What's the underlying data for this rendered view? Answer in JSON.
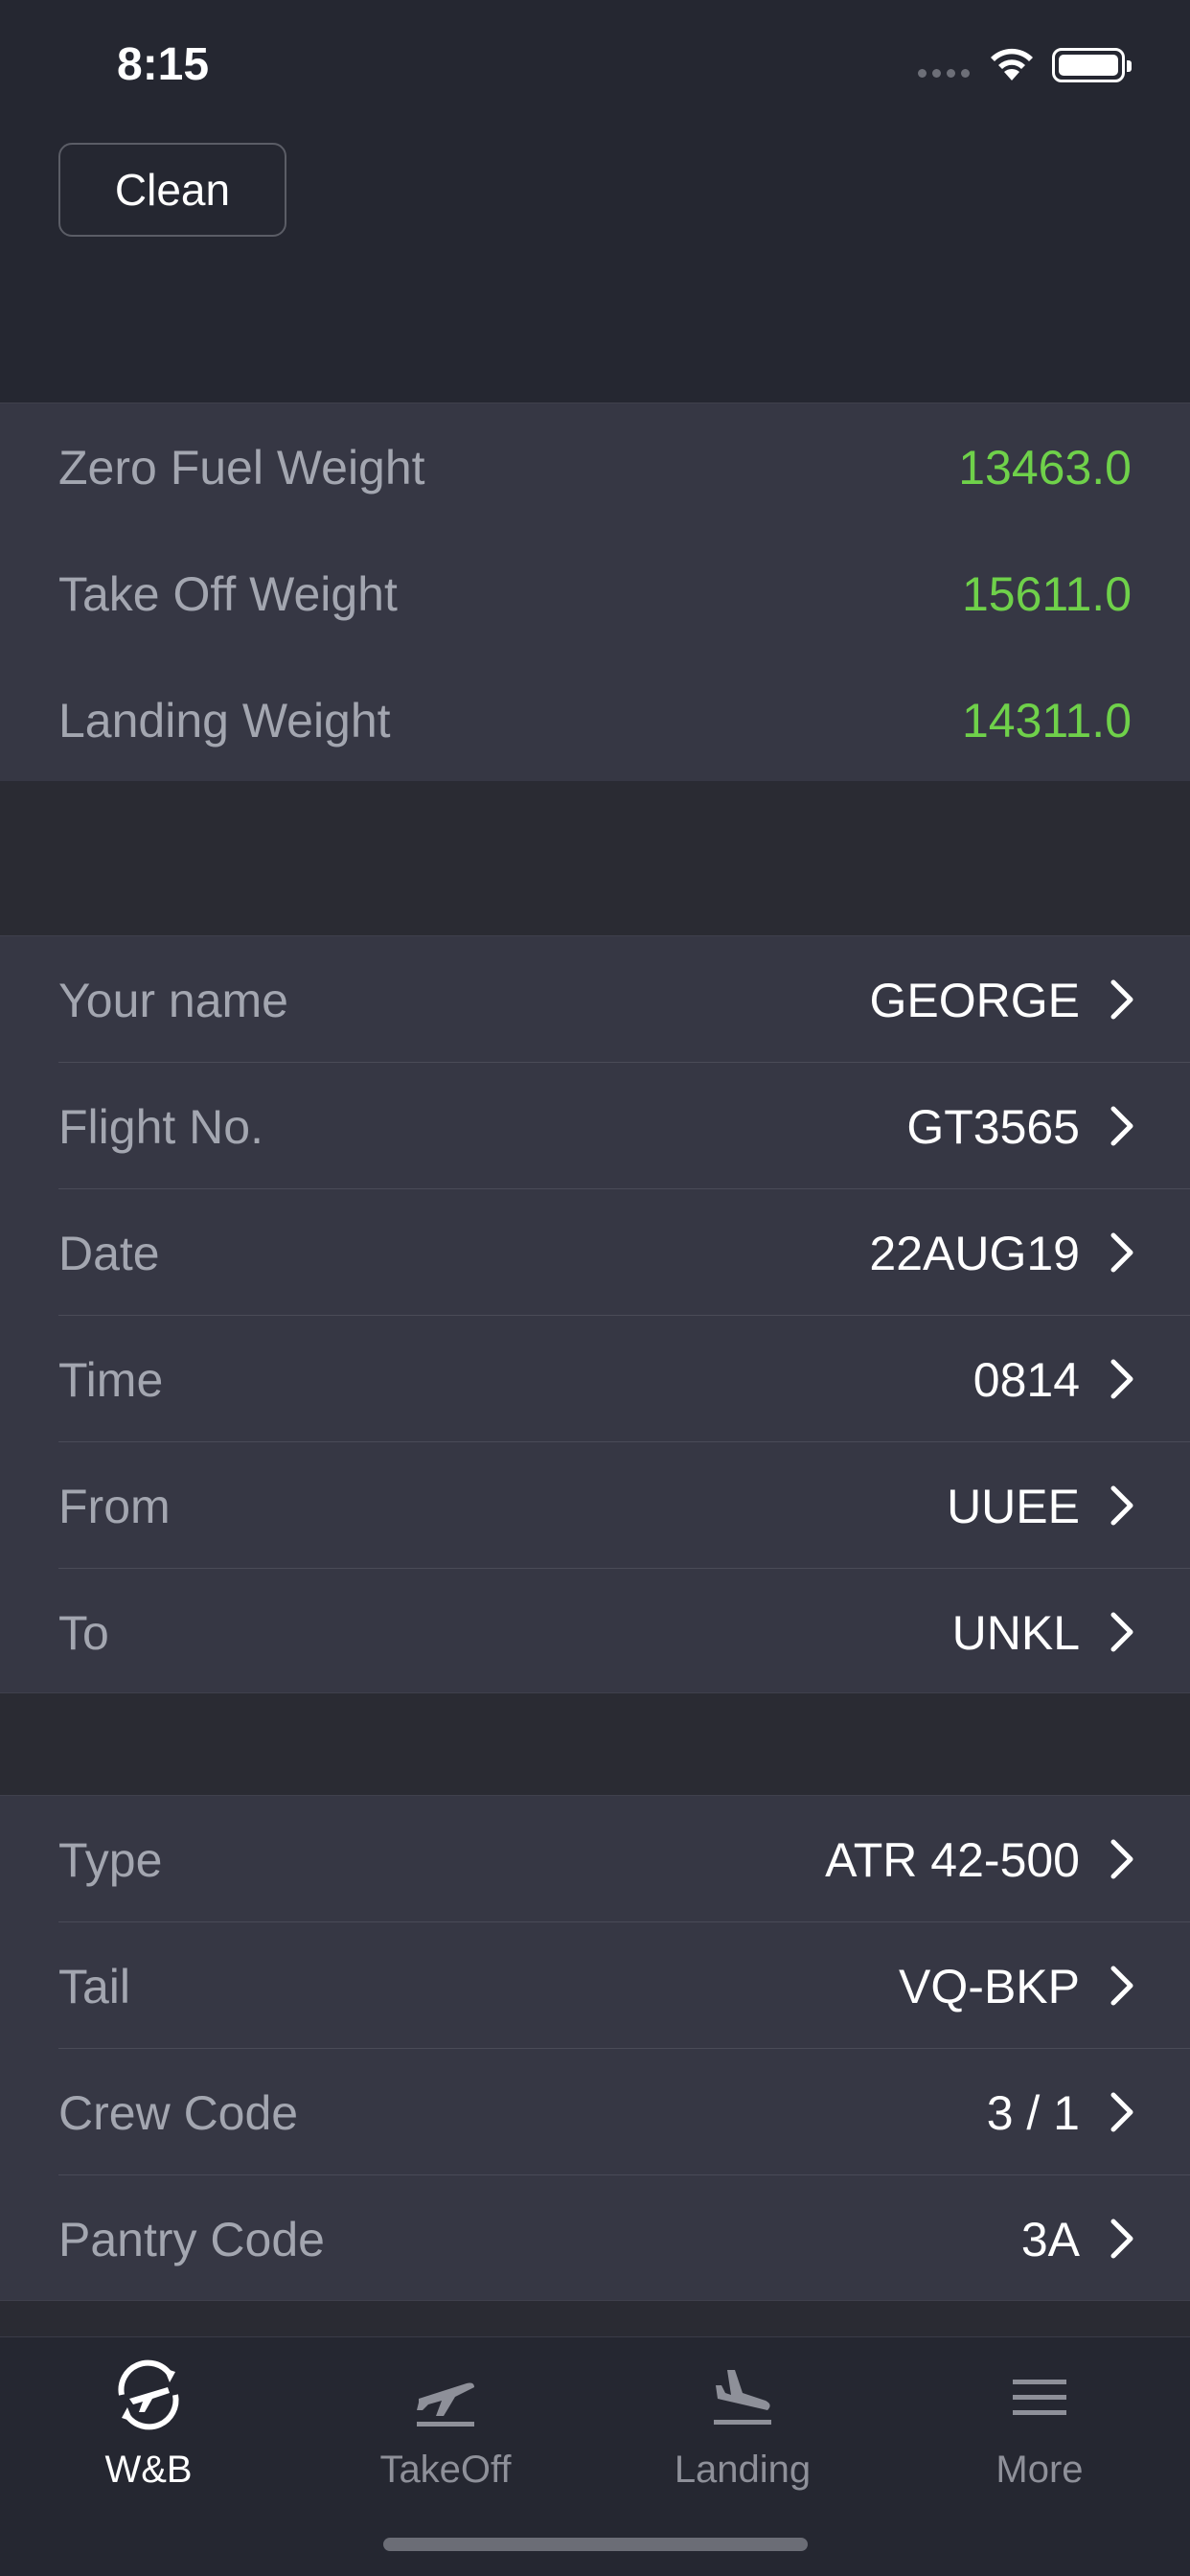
{
  "status": {
    "time": "8:15"
  },
  "header": {
    "clean_label": "Clean"
  },
  "weights": [
    {
      "label": "Zero Fuel Weight",
      "value": "13463.0"
    },
    {
      "label": "Take Off Weight",
      "value": "15611.0"
    },
    {
      "label": "Landing Weight",
      "value": "14311.0"
    }
  ],
  "flight": [
    {
      "label": "Your name",
      "value": "GEORGE"
    },
    {
      "label": "Flight No.",
      "value": "GT3565"
    },
    {
      "label": "Date",
      "value": "22AUG19"
    },
    {
      "label": "Time",
      "value": "0814"
    },
    {
      "label": "From",
      "value": "UUEE"
    },
    {
      "label": "To",
      "value": "UNKL"
    }
  ],
  "aircraft": [
    {
      "label": "Type",
      "value": "ATR 42-500"
    },
    {
      "label": "Tail",
      "value": "VQ-BKP"
    },
    {
      "label": "Crew Code",
      "value": "3 / 1"
    },
    {
      "label": "Pantry Code",
      "value": "3A"
    }
  ],
  "tabs": [
    {
      "label": "W&B",
      "icon": "weight-balance-icon",
      "active": true
    },
    {
      "label": "TakeOff",
      "icon": "takeoff-icon",
      "active": false
    },
    {
      "label": "Landing",
      "icon": "landing-icon",
      "active": false
    },
    {
      "label": "More",
      "icon": "menu-icon",
      "active": false
    }
  ],
  "colors": {
    "accent_green": "#6fd14a",
    "background": "#2a2b33",
    "cell": "#363744"
  }
}
